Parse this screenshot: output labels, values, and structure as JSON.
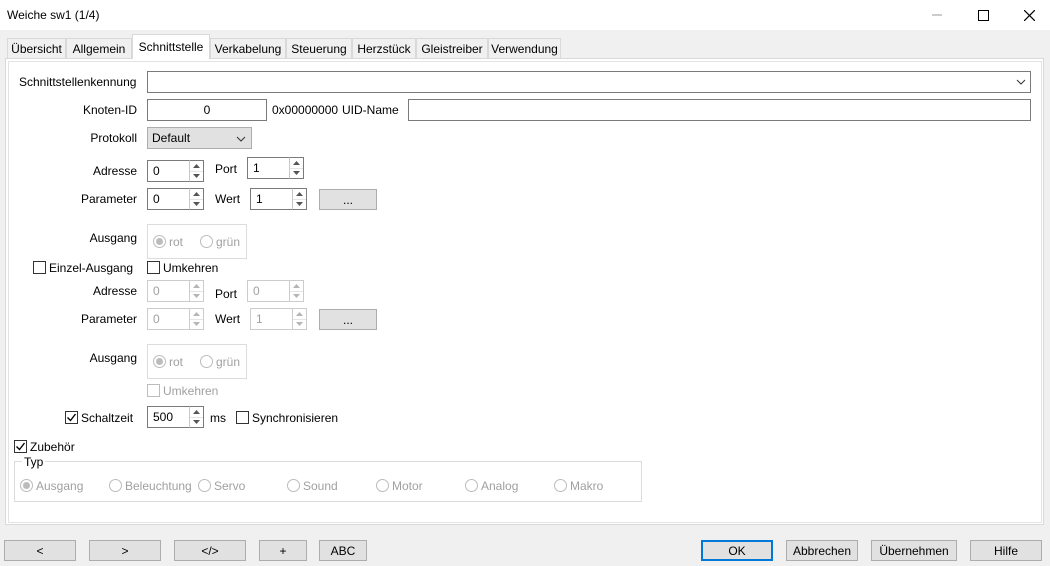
{
  "window": {
    "title": "Weiche sw1 (1/4)",
    "minimize_icon": "minimize-icon",
    "maximize_icon": "maximize-icon",
    "close_icon": "close-icon"
  },
  "tabs": [
    {
      "label": "Übersicht",
      "active": false
    },
    {
      "label": "Allgemein",
      "active": false
    },
    {
      "label": "Schnittstelle",
      "active": true
    },
    {
      "label": "Verkabelung",
      "active": false
    },
    {
      "label": "Steuerung",
      "active": false
    },
    {
      "label": "Herzstück",
      "active": false
    },
    {
      "label": "Gleistreiber",
      "active": false
    },
    {
      "label": "Verwendung",
      "active": false
    }
  ],
  "interface": {
    "id_label": "Schnittstellenkennung",
    "id_value": "",
    "node_label": "Knoten-ID",
    "node_value": "0",
    "node_hex": "0x00000000",
    "uid_label": "UID-Name",
    "uid_value": "",
    "protocol_label": "Protokoll",
    "protocol_value": "Default"
  },
  "output1": {
    "address_label": "Adresse",
    "address_value": "0",
    "port_label": "Port",
    "port_value": "1",
    "param_label": "Parameter",
    "param_value": "0",
    "value_label": "Wert",
    "value_value": "1",
    "more_button": "...",
    "output_label": "Ausgang",
    "radio_rot": "rot",
    "radio_gruen": "grün"
  },
  "single_output": {
    "checkbox_label": "Einzel-Ausgang",
    "checked": false,
    "invert_label": "Umkehren",
    "invert_checked": false
  },
  "output2": {
    "address_label": "Adresse",
    "address_value": "0",
    "port_label": "Port",
    "port_value": "0",
    "param_label": "Parameter",
    "param_value": "0",
    "value_label": "Wert",
    "value_value": "1",
    "more_button": "...",
    "output_label": "Ausgang",
    "radio_rot": "rot",
    "radio_gruen": "grün",
    "invert_label": "Umkehren"
  },
  "switch_time": {
    "checkbox_label": "Schaltzeit",
    "checked": true,
    "value": "500",
    "unit": "ms",
    "sync_label": "Synchronisieren",
    "sync_checked": false
  },
  "accessory": {
    "checkbox_label": "Zubehör",
    "checked": true,
    "group_label": "Typ",
    "types": [
      "Ausgang",
      "Beleuchtung",
      "Servo",
      "Sound",
      "Motor",
      "Analog",
      "Makro"
    ],
    "selected": "Ausgang"
  },
  "footer": {
    "prev": "<",
    "next": ">",
    "code": "</>",
    "add": "+",
    "abc": "ABC",
    "ok": "OK",
    "cancel": "Abbrechen",
    "apply": "Übernehmen",
    "help": "Hilfe"
  },
  "colors": {
    "accent": "#0078d7",
    "disabled_text": "#a0a0a0",
    "window_bg": "#f0f0f0"
  }
}
